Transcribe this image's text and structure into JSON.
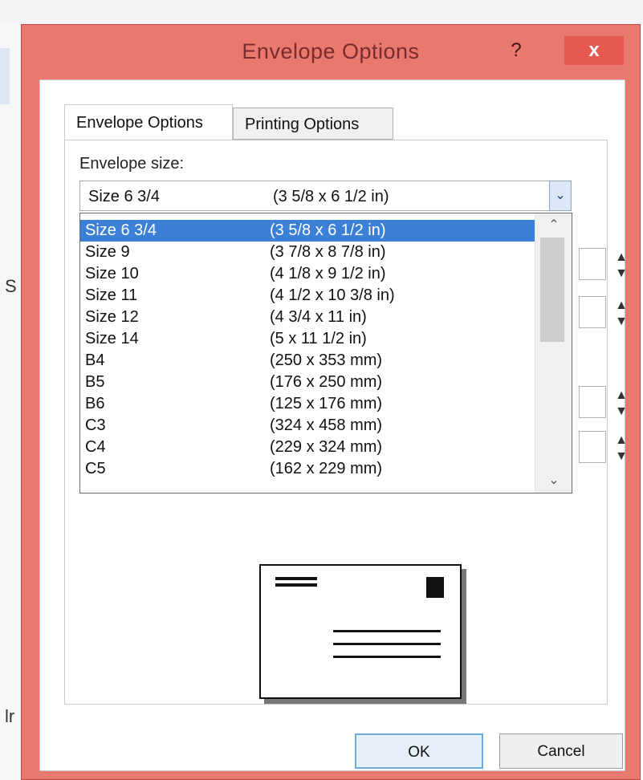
{
  "window": {
    "title": "Envelope Options",
    "help_icon": "?",
    "close_icon": "x"
  },
  "background": {
    "left_text_1": "S",
    "left_text_2": "lr"
  },
  "tabs": [
    {
      "label": "Envelope Options",
      "active": true
    },
    {
      "label": "Printing Options",
      "active": false
    }
  ],
  "envelope_size": {
    "label": "Envelope size:",
    "selected_name": "Size 6 3/4",
    "selected_dims": "(3 5/8 x 6 1/2 in)",
    "options": [
      {
        "name": "Size 6 3/4",
        "dims": "(3 5/8 x 6 1/2 in)",
        "selected": true
      },
      {
        "name": "Size 9",
        "dims": "(3 7/8 x 8 7/8 in)"
      },
      {
        "name": "Size 10",
        "dims": "(4 1/8 x 9 1/2 in)"
      },
      {
        "name": "Size 11",
        "dims": "(4 1/2 x 10 3/8 in)"
      },
      {
        "name": "Size 12",
        "dims": "(4 3/4 x 11 in)"
      },
      {
        "name": "Size 14",
        "dims": "(5 x 11 1/2 in)"
      },
      {
        "name": "B4",
        "dims": "(250 x 353 mm)"
      },
      {
        "name": "B5",
        "dims": "(176 x 250 mm)"
      },
      {
        "name": "B6",
        "dims": "(125 x 176 mm)"
      },
      {
        "name": "C3",
        "dims": "(324 x 458 mm)"
      },
      {
        "name": "C4",
        "dims": "(229 x 324 mm)"
      },
      {
        "name": "C5",
        "dims": "(162 x 229 mm)"
      }
    ]
  },
  "buttons": {
    "ok": "OK",
    "cancel": "Cancel"
  },
  "colors": {
    "frame": "#e9786f",
    "selection": "#3b80d6",
    "close_button": "#e75a50"
  }
}
